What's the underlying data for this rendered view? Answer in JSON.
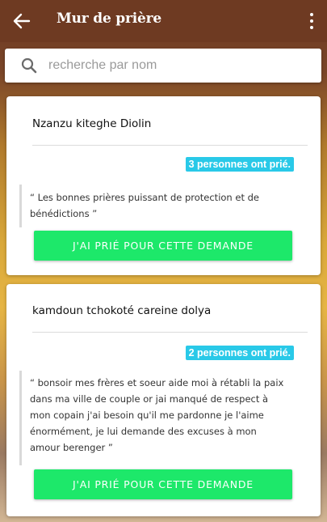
{
  "appbar": {
    "title": "Mur de prière"
  },
  "search": {
    "placeholder": "recherche par nom"
  },
  "prayers": [
    {
      "name": "Nzanzu kiteghe Diolin",
      "count_label": "3 personnes ont prié.",
      "text": "“ Les bonnes prières puissant de protection et de bénédictions ”",
      "button_label": "J'AI PRIÉ POUR CETTE DEMANDE"
    },
    {
      "name": "kamdoun tchokoté careine dolya",
      "count_label": "2 personnes ont prié.",
      "text": "“ bonsoir mes frères et soeur aide moi à rétabli la paix dans ma ville de couple or jai manqué de respect à mon copain j'ai besoin qu'il me pardonne je l'aime énormément, je lui demande des excuses à mon amour berenger ”",
      "button_label": "J'AI PRIÉ POUR CETTE DEMANDE"
    }
  ],
  "colors": {
    "appbar": "#6e3a22",
    "badge": "#29c9e8",
    "button": "#1de86a"
  },
  "icons": {
    "back": "arrow-left",
    "menu": "more-vertical",
    "search": "magnifier"
  }
}
